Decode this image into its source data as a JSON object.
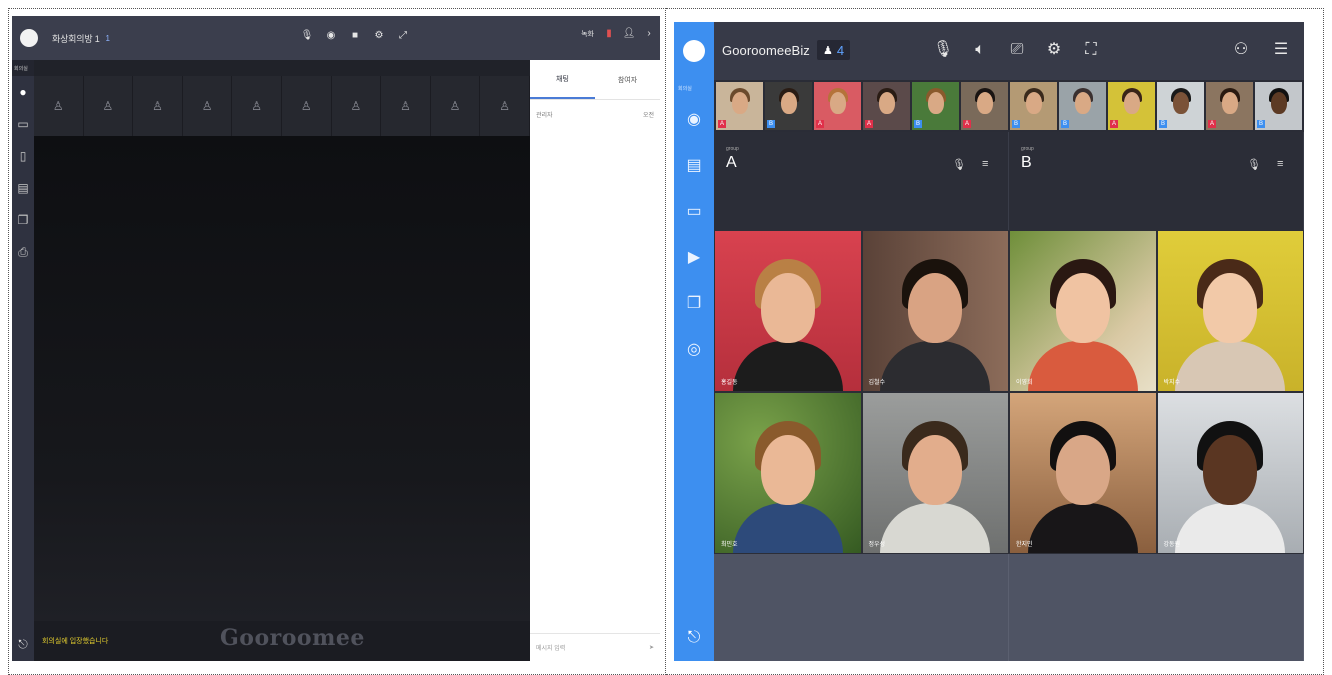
{
  "left": {
    "header": {
      "title": "화상회의방 1",
      "count": "1",
      "rec_label": "녹화"
    },
    "rail": {
      "top_label": "회의실"
    },
    "chat": {
      "tabs": [
        "채팅",
        "참여자"
      ],
      "first_row": {
        "name": "관리자",
        "time": "오전"
      },
      "input_placeholder": "메시지 입력"
    },
    "status": "회의실에 입장했습니다",
    "brand": "Gooroomee"
  },
  "right": {
    "header": {
      "title": "GooroomeeBiz",
      "count": "4"
    },
    "rail": {
      "top_label": "회의실"
    },
    "groups": [
      {
        "sub": "group",
        "name": "A"
      },
      {
        "sub": "group",
        "name": "B"
      }
    ],
    "grid_names": [
      "홍길동",
      "김철수",
      "이영희",
      "박지수",
      "최민호",
      "정우성",
      "한지민",
      "강동원"
    ],
    "thumb_badges": [
      "A",
      "B",
      "A",
      "A",
      "B",
      "A",
      "B",
      "B",
      "A",
      "B",
      "A",
      "B"
    ]
  }
}
